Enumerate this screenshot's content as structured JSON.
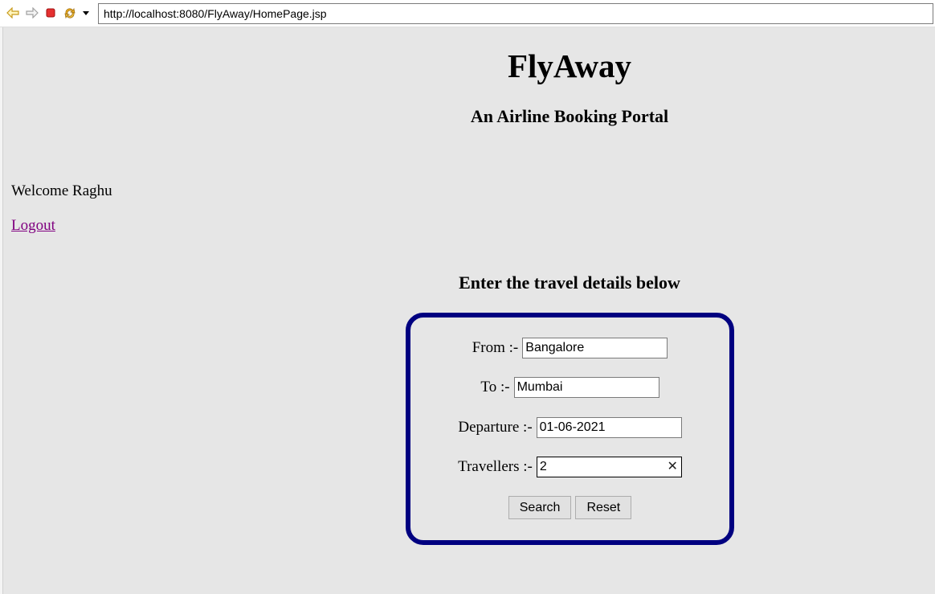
{
  "browser": {
    "url": "http://localhost:8080/FlyAway/HomePage.jsp",
    "icons": [
      "back-arrow-icon",
      "forward-arrow-icon",
      "stop-icon",
      "refresh-icon",
      "dropdown-icon"
    ]
  },
  "header": {
    "title": "FlyAway",
    "subtitle": "An Airline Booking Portal"
  },
  "user": {
    "welcome": "Welcome Raghu",
    "logout_label": "Logout"
  },
  "form": {
    "heading": "Enter the travel details below",
    "from_label": "From :-",
    "from_value": "Bangalore",
    "to_label": "To :-",
    "to_value": "Mumbai",
    "departure_label": "Departure :-",
    "departure_value": "01-06-2021",
    "travellers_label": "Travellers :-",
    "travellers_value": "2",
    "clear_glyph": "✕",
    "search_label": "Search",
    "reset_label": "Reset"
  },
  "colors": {
    "page_background": "#e6e6e6",
    "form_border": "#000080",
    "link_visited": "#800080"
  }
}
